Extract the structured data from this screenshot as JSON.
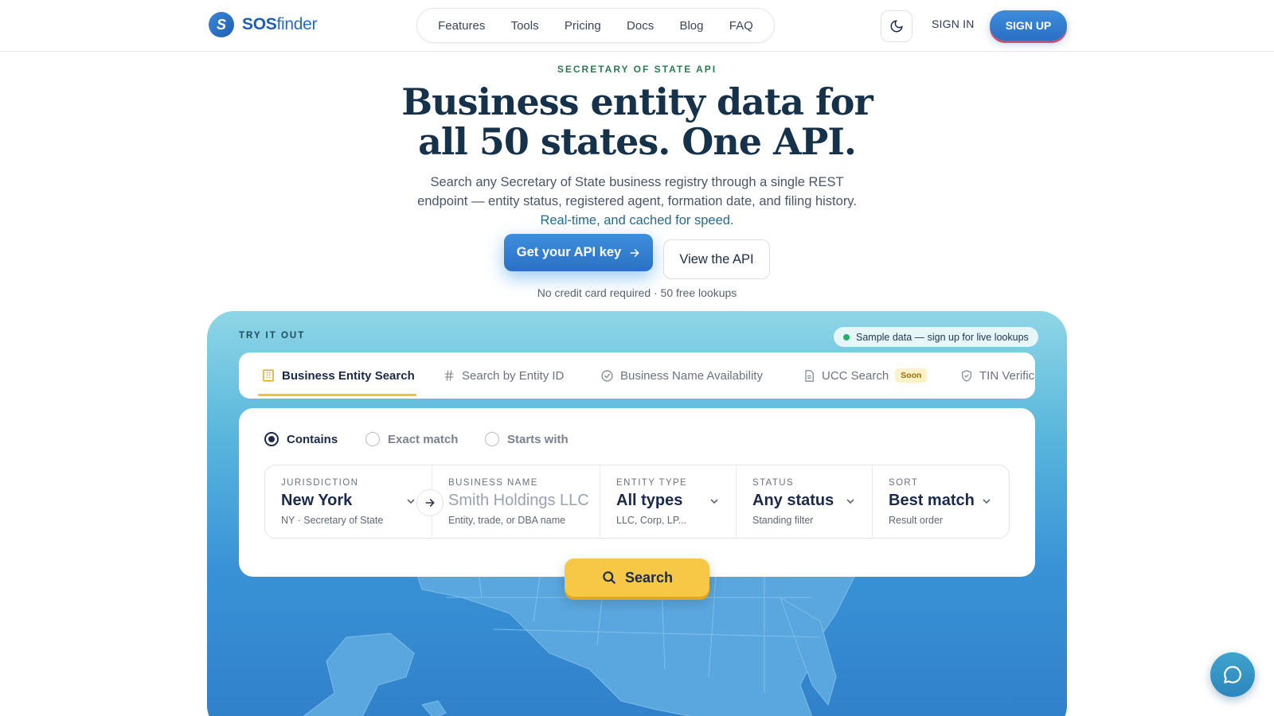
{
  "brand": {
    "name_bold": "SOS",
    "name_rest": "finder"
  },
  "nav": {
    "items": [
      "Features",
      "Tools",
      "Pricing",
      "Docs",
      "Blog",
      "FAQ"
    ]
  },
  "header": {
    "signin": "SIGN IN",
    "signup": "SIGN UP"
  },
  "hero": {
    "eyebrow": "SECRETARY OF STATE API",
    "title_line1": "Business entity data for",
    "title_line2": "all 50 states. One API.",
    "subtitle_line1": "Search any Secretary of State business registry through a single REST",
    "subtitle_line2": "endpoint — entity status, registered agent, formation date, and filing history.",
    "subtitle_line3": "Real-time, and cached for speed.",
    "cta_primary": "Get your API key",
    "cta_secondary": "View the API",
    "note": "No credit card required · 50 free lookups"
  },
  "demo": {
    "label": "TRY IT OUT",
    "sample_pill": "Sample data — sign up for live lookups",
    "tabs": [
      {
        "label": "Business Entity Search",
        "icon": "building-icon",
        "active": true
      },
      {
        "label": "Search by Entity ID",
        "icon": "hash-icon"
      },
      {
        "label": "Business Name Availability",
        "icon": "check-circle-icon"
      },
      {
        "label": "UCC Search",
        "icon": "document-icon",
        "badge": "Soon"
      },
      {
        "label": "TIN Verification",
        "icon": "shield-icon"
      }
    ],
    "match_modes": [
      {
        "label": "Contains",
        "selected": true
      },
      {
        "label": "Exact match",
        "selected": false
      },
      {
        "label": "Starts with",
        "selected": false
      }
    ],
    "fields": [
      {
        "label": "JURISDICTION",
        "value": "New York",
        "hint": "NY · Secretary of State"
      },
      {
        "label": "BUSINESS NAME",
        "placeholder": "Smith Holdings LLC",
        "hint": "Entity, trade, or DBA name"
      },
      {
        "label": "ENTITY TYPE",
        "value": "All types",
        "hint": "LLC, Corp, LP..."
      },
      {
        "label": "STATUS",
        "value": "Any status",
        "hint": "Standing filter"
      },
      {
        "label": "SORT",
        "value": "Best match",
        "hint": "Result order"
      }
    ],
    "search_button": "Search"
  },
  "colors": {
    "primary": "#2b70c5",
    "accent": "#f6c846",
    "ink": "#1b2a4a"
  }
}
